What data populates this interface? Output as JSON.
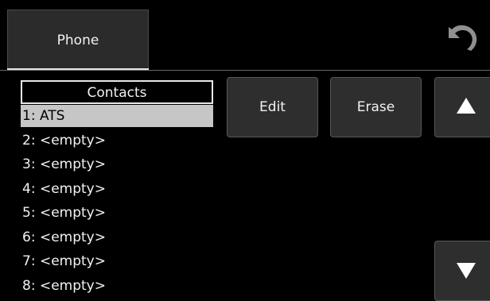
{
  "header": {
    "phone_tab_label": "Phone",
    "back_icon": "back-arrow-icon"
  },
  "contacts": {
    "title": "Contacts",
    "items": [
      "1: ATS",
      "2: <empty>",
      "3: <empty>",
      "4: <empty>",
      "5: <empty>",
      "6: <empty>",
      "7: <empty>",
      "8: <empty>"
    ],
    "selected_index": 0
  },
  "actions": {
    "edit_label": "Edit",
    "erase_label": "Erase",
    "scroll_up_icon": "triangle-up-icon",
    "scroll_down_icon": "triangle-down-icon"
  },
  "colors": {
    "background": "#000000",
    "button_bg": "#2e2e2e",
    "selection_bg": "#c6c6c6",
    "text": "#f2f2f2"
  }
}
